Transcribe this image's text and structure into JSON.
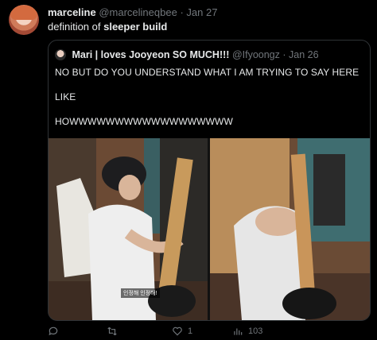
{
  "tweet": {
    "author_name": "marceline",
    "handle": "@marcelineqbee",
    "separator": "·",
    "date": "Jan 27",
    "text_plain": "definition of ",
    "text_bold": "sleeper build"
  },
  "quote": {
    "author_name": "Mari | loves Jooyeon SO MUCH!!!",
    "handle": "@Ifyoongz",
    "separator": "·",
    "date": "Jan 26",
    "line1": "NO BUT DO YOU UNDERSTAND WHAT I AM TRYING TO SAY HERE",
    "line2": "LIKE",
    "line3": "HOWWWWWWWWWWWWWWWWWW",
    "media_caption": "인정해 인정해!"
  },
  "actions": {
    "reply_count": "",
    "retweet_count": "",
    "like_count": "1",
    "views_count": "103",
    "icons": [
      "reply-icon",
      "retweet-icon",
      "like-icon",
      "views-icon"
    ]
  },
  "colors": {
    "background": "#000000",
    "text": "#e7e9ea",
    "muted": "#71767b",
    "border": "#2f3336"
  }
}
